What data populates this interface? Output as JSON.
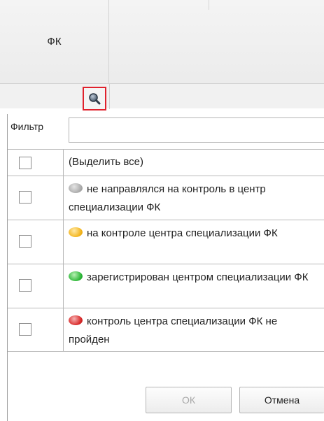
{
  "header": {
    "column_title": "ФК"
  },
  "filter": {
    "label": "Фильтр",
    "value": ""
  },
  "list": {
    "items": [
      {
        "label": "(Выделить все)",
        "status": null,
        "checked": false
      },
      {
        "label": "не направлялся на контроль в центр специализации ФК",
        "status": "gray",
        "checked": false
      },
      {
        "label": "на контроле центра специализации ФК",
        "status": "yellow",
        "checked": false
      },
      {
        "label": "зарегистрирован центром специализации ФК",
        "status": "green",
        "checked": false
      },
      {
        "label": "контроль центра специализации ФК не пройден",
        "status": "red",
        "checked": false
      }
    ]
  },
  "buttons": {
    "ok_label": "ОК",
    "cancel_label": "Отмена"
  },
  "colors": {
    "highlight_border": "#e0212c",
    "gray": "#a7a7a7",
    "yellow": "#f3b51d",
    "green": "#2fb839",
    "red": "#d92a2a"
  },
  "icons": {
    "filter_search": "magnifier-icon"
  }
}
